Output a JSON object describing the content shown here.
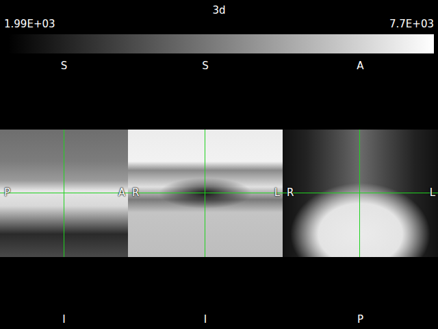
{
  "window": {
    "title": "3d"
  },
  "colorbar": {
    "min": "1.99E+03",
    "max": "7.7E+03"
  },
  "views": [
    {
      "name": "sagittal",
      "top": "S",
      "bottom": "I",
      "left": "P",
      "right": "A"
    },
    {
      "name": "coronal",
      "top": "S",
      "bottom": "I",
      "left": "R",
      "right": "L"
    },
    {
      "name": "axial",
      "top": "A",
      "bottom": "P",
      "left": "R",
      "right": "L"
    }
  ]
}
